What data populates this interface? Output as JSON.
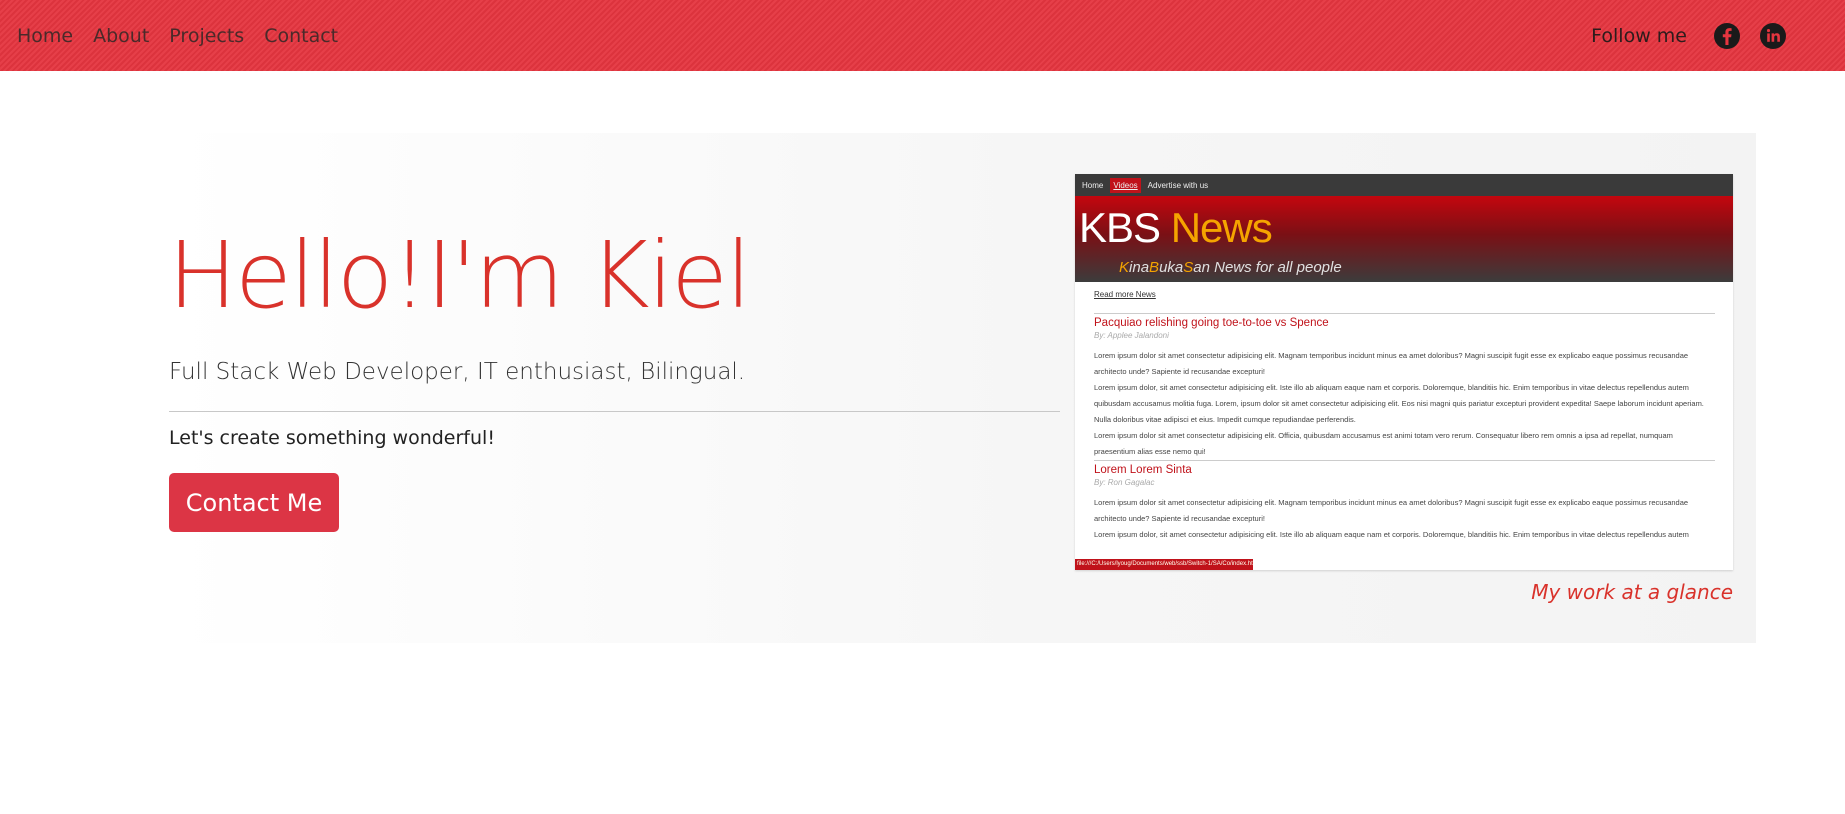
{
  "nav": {
    "links": [
      "Home",
      "About",
      "Projects",
      "Contact"
    ],
    "follow_label": "Follow me",
    "social_icons": [
      "facebook-icon",
      "linkedin-icon"
    ]
  },
  "hero": {
    "title": "Hello!I'm Kiel",
    "subtitle": "Full Stack Web Developer, IT enthusiast, Bilingual.",
    "lead": "Let's create something wonderful!",
    "cta_label": "Contact Me",
    "preview_caption": "My work at a glance"
  },
  "preview": {
    "nav": [
      "Home",
      "Videos",
      "Advertise with us"
    ],
    "brand_main": "KBS",
    "brand_accent": "News",
    "tagline_k1": "K",
    "tagline_t1": "ina",
    "tagline_k2": "B",
    "tagline_t2": "uka",
    "tagline_k3": "S",
    "tagline_t3": "an News for all people",
    "read_more": "Read more News",
    "articles": [
      {
        "title": "Pacquiao relishing going toe-to-toe vs Spence",
        "byline": "By: Applee Jalandoni",
        "paragraphs": [
          "Lorem ipsum dolor sit amet consectetur adipisicing elit. Magnam temporibus incidunt minus ea amet doloribus? Magni suscipit fugit esse ex explicabo eaque possimus recusandae architecto unde? Sapiente id recusandae excepturi!",
          "Lorem ipsum dolor, sit amet consectetur adipisicing elit. Iste illo ab aliquam eaque nam et corporis. Doloremque, blanditiis hic. Enim temporibus in vitae delectus repellendus autem quibusdam accusamus molitia fuga. Lorem, ipsum dolor sit amet consectetur adipisicing elit. Eos nisi magni quis pariatur excepturi provident expedita! Saepe laborum incidunt aperiam. Nulla doloribus vitae adipisci et eius. Impedit cumque repudiandae perferendis.",
          "Lorem ipsum dolor sit amet consectetur adipisicing elit. Officia, quibusdam accusamus est animi totam vero rerum. Consequatur libero rem omnis a ipsa ad repellat, numquam praesentium alias esse nemo qui!"
        ]
      },
      {
        "title": "Lorem Lorem Sinta",
        "byline": "By: Ron Gagalac",
        "paragraphs": [
          "Lorem ipsum dolor sit amet consectetur adipisicing elit. Magnam temporibus incidunt minus ea amet doloribus? Magni suscipit fugit esse ex explicabo eaque possimus recusandae architecto unde? Sapiente id recusandae excepturi!",
          "Lorem ipsum dolor, sit amet consectetur adipisicing elit. Iste illo ab aliquam eaque nam et corporis. Doloremque, blanditiis hic. Enim temporibus in vitae delectus repellendus autem"
        ]
      }
    ],
    "status_url": "file:///C:/Users/lyoug/Documents/web/ssb/Switch-1/SA/Co/index.html#"
  },
  "colors": {
    "brand_red": "#e5353f",
    "title_red": "#d9322b",
    "button_red": "#dc3545"
  }
}
